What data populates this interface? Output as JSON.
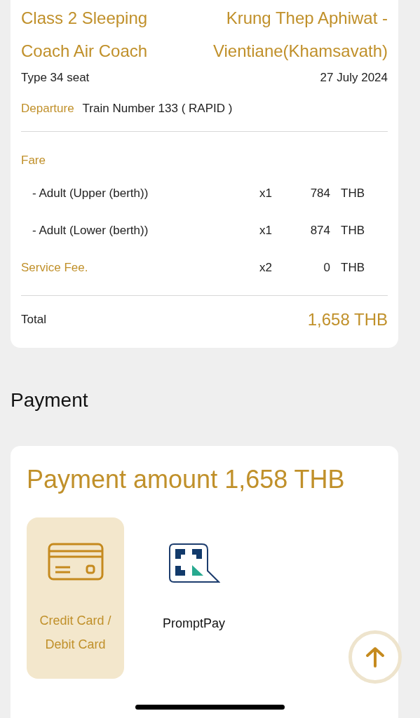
{
  "trip": {
    "coach_class": "Class 2 Sleeping Coach Air Coach",
    "route": "Krung Thep Aphiwat - Vientiane(Khamsavath)",
    "seat_type": "Type 34 seat",
    "date": "27 July 2024",
    "departure_label": "Departure",
    "train": "Train Number 133 ( RAPID )"
  },
  "fare": {
    "heading": "Fare",
    "rows": [
      {
        "kind": "passenger",
        "label": "- Adult (Upper (berth))",
        "qty": "x1",
        "amount": "784",
        "currency": "THB"
      },
      {
        "kind": "passenger",
        "label": "- Adult (Lower (berth))",
        "qty": "x1",
        "amount": "874",
        "currency": "THB"
      },
      {
        "kind": "fee",
        "label": "Service Fee.",
        "qty": "x2",
        "amount": "0",
        "currency": "THB"
      }
    ],
    "total_label": "Total",
    "total": "1,658 THB"
  },
  "payment": {
    "heading": "Payment",
    "amount_label": "Payment amount",
    "amount": "1,658 THB",
    "methods": [
      {
        "kind": "card",
        "label": "Credit Card / Debit Card",
        "selected": true
      },
      {
        "kind": "promptpay",
        "label": "PromptPay",
        "selected": false
      }
    ]
  }
}
